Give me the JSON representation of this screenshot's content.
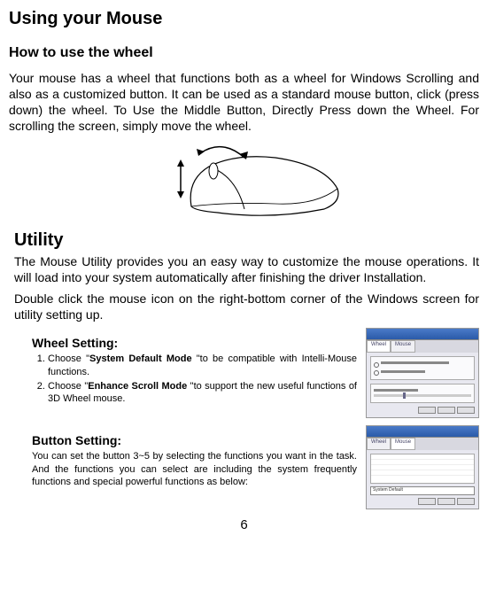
{
  "title": "Using your Mouse",
  "section_a": {
    "heading": "How to use the wheel",
    "paragraph": "Your mouse has a wheel that functions both as a wheel for Windows Scrolling and also as a customized button. It can be used as a standard mouse button, click (press down) the wheel. To Use the Middle Button, Directly Press down the Wheel. For scrolling the screen, simply move the wheel."
  },
  "utility": {
    "heading": "Utility",
    "paragraph1": "The Mouse Utility provides you an easy way to customize the mouse operations. It will load into your system automatically after finishing the driver Installation.",
    "paragraph2": "Double click the mouse icon on the right-bottom corner of the Windows screen for utility setting up."
  },
  "wheel_setting": {
    "heading": "Wheel Setting:",
    "item1_pre": "Choose \"",
    "item1_bold": "System Default Mode",
    "item1_post": " \"to be compatible with Intelli-Mouse functions.",
    "item2_pre": "Choose \"",
    "item2_bold": "Enhance Scroll Mode",
    "item2_post": " \"to support the new useful functions of 3D Wheel mouse."
  },
  "button_setting": {
    "heading": "Button Setting:",
    "paragraph": "You can set the button 3~5 by selecting the functions you want in the task. And the functions you can select are including the system frequently functions and special powerful functions as below:"
  },
  "page_number": "6",
  "thumb1": {
    "tab1": "Wheel",
    "tab2": "Mouse"
  },
  "thumb2": {
    "tab1": "Wheel",
    "tab2": "Mouse",
    "dropdown": "System Default"
  }
}
